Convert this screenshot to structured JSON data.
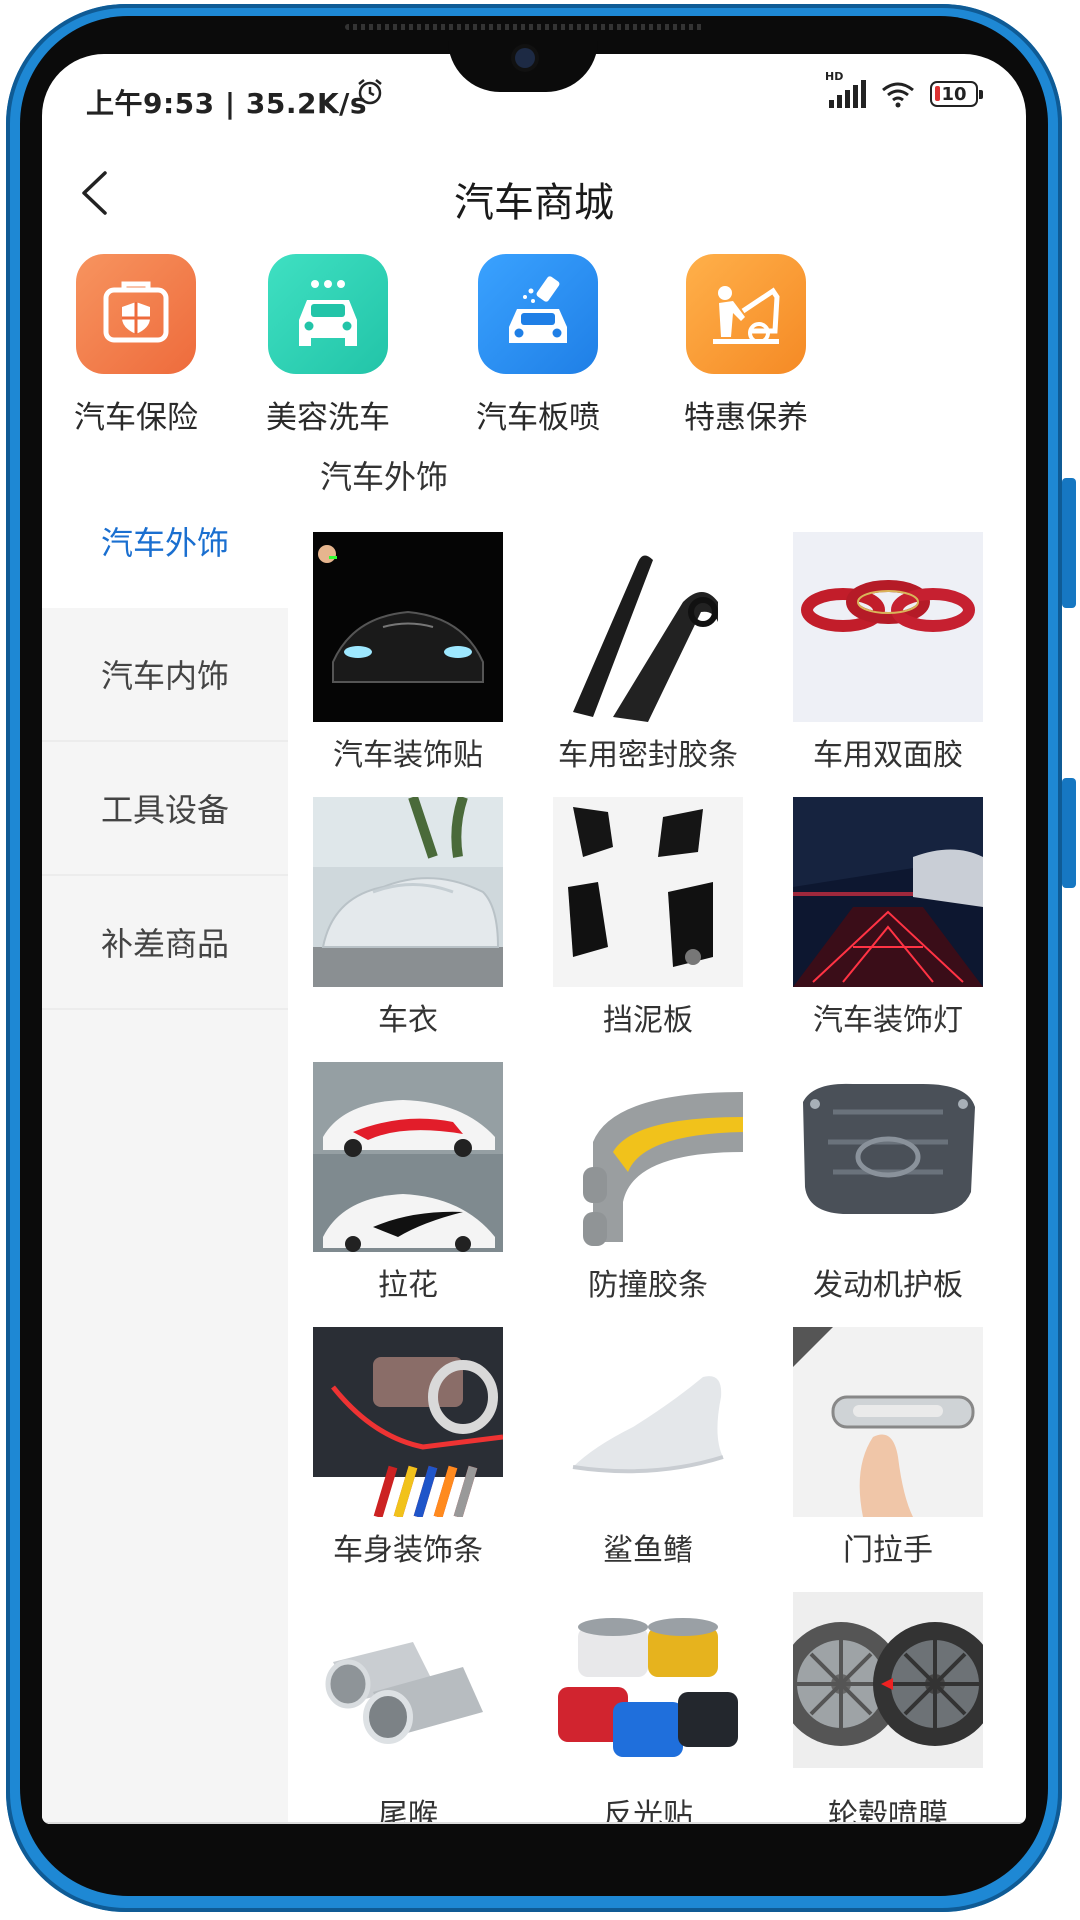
{
  "status_bar": {
    "time": "上午9:53 | 35.2K/s",
    "signal_label": "HD",
    "battery": "10"
  },
  "header": {
    "title": "汽车商城"
  },
  "services": [
    {
      "label": "汽车保险",
      "icon": "car-insurance-shield-icon",
      "color": "#f07a4a"
    },
    {
      "label": "美容洗车",
      "icon": "car-wash-icon",
      "color": "#2fd3b6"
    },
    {
      "label": "汽车板喷",
      "icon": "car-paint-spray-icon",
      "color": "#2f8ff0"
    },
    {
      "label": "特惠保养",
      "icon": "car-maintenance-icon",
      "color": "#f59a35"
    }
  ],
  "sidebar": {
    "items": [
      {
        "label": "汽车外饰",
        "active": true
      },
      {
        "label": "汽车内饰",
        "active": false
      },
      {
        "label": "工具设备",
        "active": false
      },
      {
        "label": "补差商品",
        "active": false
      }
    ]
  },
  "section": {
    "title": "汽车外饰"
  },
  "products": [
    {
      "name": "汽车装饰贴"
    },
    {
      "name": "车用密封胶条"
    },
    {
      "name": "车用双面胶"
    },
    {
      "name": "车衣"
    },
    {
      "name": "挡泥板"
    },
    {
      "name": "汽车装饰灯"
    },
    {
      "name": "拉花"
    },
    {
      "name": "防撞胶条"
    },
    {
      "name": "发动机护板"
    },
    {
      "name": "车身装饰条"
    },
    {
      "name": "鲨鱼鳍"
    },
    {
      "name": "门拉手"
    },
    {
      "name": "尾喉"
    },
    {
      "name": "反光贴"
    },
    {
      "name": "轮毂喷膜"
    }
  ],
  "colors": {
    "accent": "#1a6fd0",
    "frame": "#1e88d4"
  }
}
